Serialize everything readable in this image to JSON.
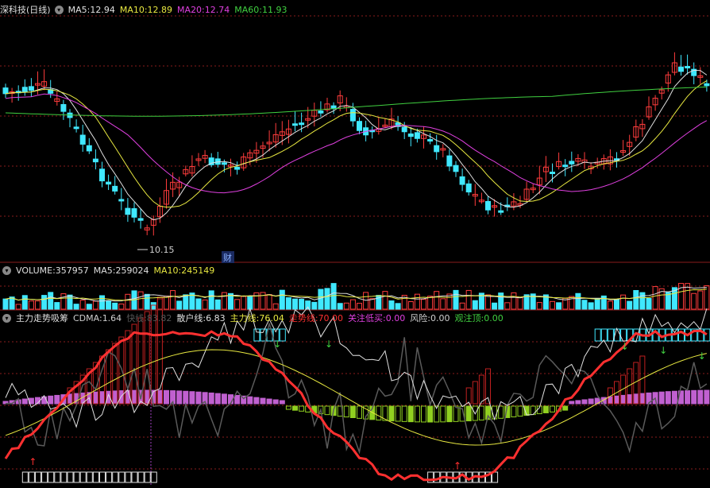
{
  "main_panel": {
    "stock_name": "深科技(日线)",
    "ma5": {
      "label": "MA5:",
      "value": "12.94",
      "color": "#e0e0e0"
    },
    "ma10": {
      "label": "MA10:",
      "value": "12.89",
      "color": "#e8e840"
    },
    "ma20": {
      "label": "MA20:",
      "value": "12.74",
      "color": "#e040e0"
    },
    "ma60": {
      "label": "MA60:",
      "value": "11.93",
      "color": "#40d040"
    },
    "low_label": "10.15",
    "event_tag": "财"
  },
  "volume_panel": {
    "title": "VOLUME:",
    "value": "357957",
    "ma5_label": "MA5:",
    "ma5_value": "259024",
    "ma10_label": "MA10:",
    "ma10_value": "245149"
  },
  "indicator_panel": {
    "title": "主力走势吸筹",
    "cdma": {
      "label": "CDMA:",
      "value": "1.64",
      "color": "#d0d0d0"
    },
    "kuaixian": {
      "label": "快线:",
      "value": "83.82",
      "color": "#505050"
    },
    "sanhu": {
      "label": "散户线:",
      "value": "6.83",
      "color": "#e0e0e0"
    },
    "zhuli": {
      "label": "主力线:",
      "value": "76.04",
      "color": "#e8e840"
    },
    "zoushi": {
      "label": "走势线:",
      "value": "70.00",
      "color": "#ff3030"
    },
    "guanzhu": {
      "label": "关注低买:",
      "value": "0.00",
      "color": "#e040e0"
    },
    "fengxian": {
      "label": "风险:",
      "value": "0.00",
      "color": "#d0d0d0"
    },
    "guanzhuding": {
      "label": "观注顶:",
      "value": "0.00",
      "color": "#40d040"
    }
  },
  "colors": {
    "up": "#ff3c3c",
    "down": "#40e8ff",
    "ma5": "#e0e0e0",
    "ma10": "#e8e840",
    "ma20": "#e040e0",
    "ma60": "#40d040",
    "grid": "#8a1c1c"
  },
  "icons": [
    "collapse-circle-icon"
  ]
}
